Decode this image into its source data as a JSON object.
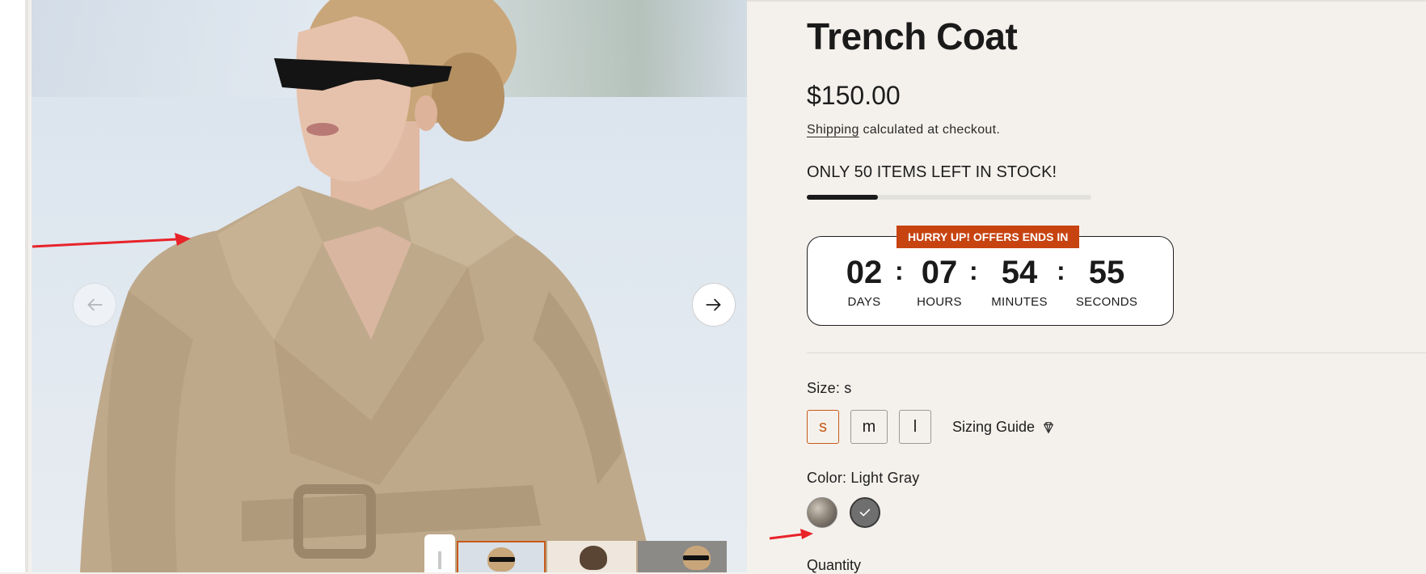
{
  "product": {
    "title": "Trench Coat",
    "price": "$150.00",
    "shipping_link": "Shipping",
    "shipping_suffix": "calculated at checkout.",
    "stock_message": "ONLY 50 ITEMS LEFT IN STOCK!",
    "stock_progress_fraction": 0.25
  },
  "countdown": {
    "badge": "HURRY UP! OFFERS ENDS IN",
    "separator": ":",
    "units": [
      {
        "value": "02",
        "label": "DAYS"
      },
      {
        "value": "07",
        "label": "HOURS"
      },
      {
        "value": "54",
        "label": "MINUTES"
      },
      {
        "value": "55",
        "label": "SECONDS"
      }
    ]
  },
  "size": {
    "label": "Size: s",
    "options": [
      "s",
      "m",
      "l"
    ],
    "selected": "s",
    "guide_label": "Sizing Guide"
  },
  "color": {
    "label": "Color: Light Gray",
    "swatches": [
      "fabric-pattern",
      "light-gray"
    ],
    "selected": "light-gray"
  },
  "quantity": {
    "label": "Quantity"
  },
  "gallery": {
    "prev_icon": "arrow-left-icon",
    "next_icon": "arrow-right-icon",
    "pause_icon": "pause-icon",
    "thumbnail_count": 3
  },
  "colors": {
    "accent": "#c74411",
    "selected_border": "#c75a18",
    "background": "#f4f1ec"
  }
}
